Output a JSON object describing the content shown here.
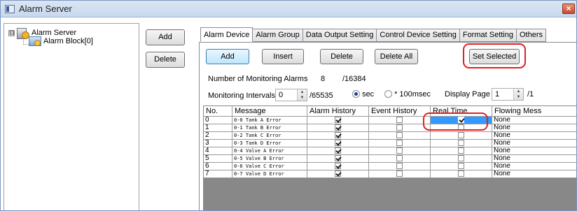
{
  "window": {
    "title": "Alarm Server",
    "close_glyph": "×"
  },
  "tree": {
    "root_label": "Alarm Server",
    "child_label": "Alarm Block[0]",
    "expander": "⊟"
  },
  "left_buttons": {
    "add": "Add",
    "delete": "Delete"
  },
  "tabs": [
    "Alarm Device",
    "Alarm Group",
    "Data Output Setting",
    "Control Device Setting",
    "Format Setting",
    "Others"
  ],
  "toolbar": {
    "add": "Add",
    "insert": "Insert",
    "delete": "Delete",
    "delete_all": "Delete All",
    "set_selected": "Set Selected"
  },
  "monitoring": {
    "count_label": "Number of Monitoring Alarms",
    "count": "8",
    "max": "/16384",
    "interval_label": "Monitoring Intervals",
    "interval_value": "0",
    "interval_max": "/65535",
    "unit_sec": "sec",
    "unit_100ms": "* 100msec",
    "page_label": "Display Page",
    "page_value": "1",
    "page_max": "/1"
  },
  "grid": {
    "headers": [
      "No.",
      "Message",
      "Alarm History",
      "Event History",
      "Real Time",
      "Flowing Mess"
    ],
    "rows": [
      {
        "no": "0",
        "message": "0-0 Tank A Error",
        "alarm_history": true,
        "event_history": false,
        "real_time": true,
        "flowing": "None"
      },
      {
        "no": "1",
        "message": "0-1 Tank B Error",
        "alarm_history": true,
        "event_history": false,
        "real_time": false,
        "flowing": "None"
      },
      {
        "no": "2",
        "message": "0-2 Tank C Error",
        "alarm_history": true,
        "event_history": false,
        "real_time": false,
        "flowing": "None"
      },
      {
        "no": "3",
        "message": "0-3 Tank D Error",
        "alarm_history": true,
        "event_history": false,
        "real_time": false,
        "flowing": "None"
      },
      {
        "no": "4",
        "message": "0-4 Valve A Error",
        "alarm_history": true,
        "event_history": false,
        "real_time": false,
        "flowing": "None"
      },
      {
        "no": "5",
        "message": "0-5 Valve B Error",
        "alarm_history": true,
        "event_history": false,
        "real_time": false,
        "flowing": "None"
      },
      {
        "no": "6",
        "message": "0-6 Valve C Error",
        "alarm_history": true,
        "event_history": false,
        "real_time": false,
        "flowing": "None"
      },
      {
        "no": "7",
        "message": "0-7 Valve D Error",
        "alarm_history": true,
        "event_history": false,
        "real_time": false,
        "flowing": "None"
      }
    ]
  },
  "colors": {
    "highlight": "#e02020",
    "selection": "#3399ff"
  }
}
